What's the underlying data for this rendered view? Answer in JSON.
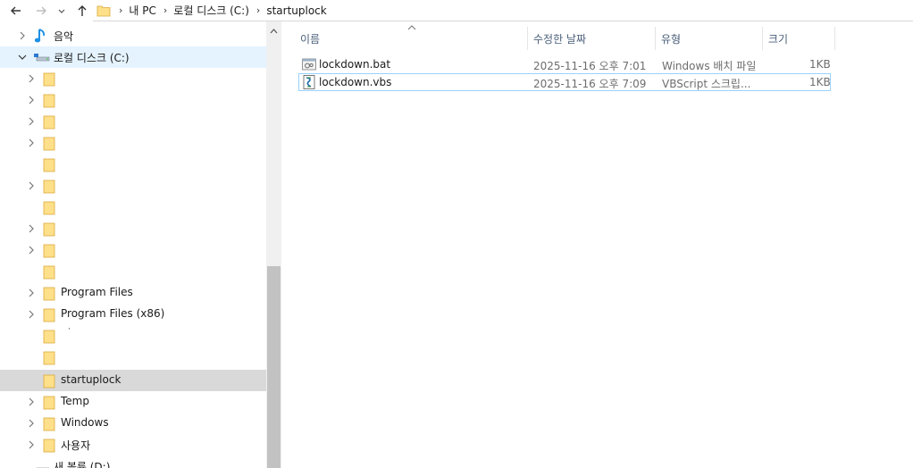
{
  "address": {
    "crumbs": [
      "내 PC",
      "로컬 디스크 (C:)",
      "startuplock"
    ]
  },
  "tree": {
    "music": "음악",
    "drive_c": "로컬 디스크 (C:)",
    "program_files": "Program Files",
    "program_files_x86": "Program Files (x86)",
    "stray_dot": "·",
    "startuplock": "startuplock",
    "temp": "Temp",
    "windows": "Windows",
    "users": "사용자",
    "drive_d_partial": "새 볼륨 (D:)"
  },
  "columns": {
    "name": "이름",
    "date": "수정한 날짜",
    "type": "유형",
    "size": "크기"
  },
  "files": [
    {
      "name": "lockdown.bat",
      "date": "2025-11-16 오후 7:01",
      "type": "Windows 배치 파일",
      "size": "1KB",
      "icon": "batch-file-icon"
    },
    {
      "name": "lockdown.vbs",
      "date": "2025-11-16 오후 7:09",
      "type": "VBScript 스크립...",
      "size": "1KB",
      "icon": "vbscript-file-icon"
    }
  ],
  "colors": {
    "selected_row": "#d9d9d9",
    "focus_outline": "#99d1ff",
    "folder_yellow": "#ffe08a",
    "header_text": "#4c607a"
  }
}
